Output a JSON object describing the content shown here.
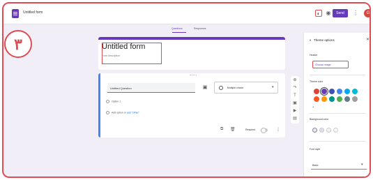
{
  "app": {
    "doc_title": "Untitled form"
  },
  "toolbar": {
    "palette_icon": "palette-icon",
    "preview_icon": "eye-icon",
    "settings_icon": "gear-icon",
    "send_label": "Send",
    "more_icon": "more-vert-icon",
    "avatar_letter": "G"
  },
  "tabs": [
    {
      "label": "Questions",
      "active": true
    },
    {
      "label": "Responses",
      "active": false
    }
  ],
  "callout": {
    "number": "۳"
  },
  "form": {
    "title": "Untitled form",
    "description": "Form description"
  },
  "question": {
    "title": "Untitled Question",
    "type": "Multiple choice",
    "option_1": "Option 1",
    "add_option": "Add option",
    "add_other_prefix": "or",
    "add_other": "add \"Other\"",
    "required_label": "Required"
  },
  "theme_panel": {
    "header": "Theme options",
    "header_section": "Header",
    "choose_image": "Choose image",
    "theme_color": "Theme color",
    "background_color": "Background color",
    "font_style": "Font style",
    "font_value": "Basic",
    "theme_colors": [
      "#db4437",
      "#673ab7",
      "#3f51b5",
      "#4285f4",
      "#03a9f4",
      "#00bcd4",
      "#ff5722",
      "#ff9800",
      "#009688",
      "#4caf50",
      "#607d8b",
      "#9e9e9e"
    ],
    "selected_color_index": 1,
    "background_colors": [
      "#ede7f6",
      "#e3dcf0",
      "#f4f4f4",
      "#f8f8f8"
    ],
    "selected_background_index": 0
  },
  "colors": {
    "accent": "#673ab7",
    "highlight": "#e04b52",
    "focus": "#4285f4"
  }
}
